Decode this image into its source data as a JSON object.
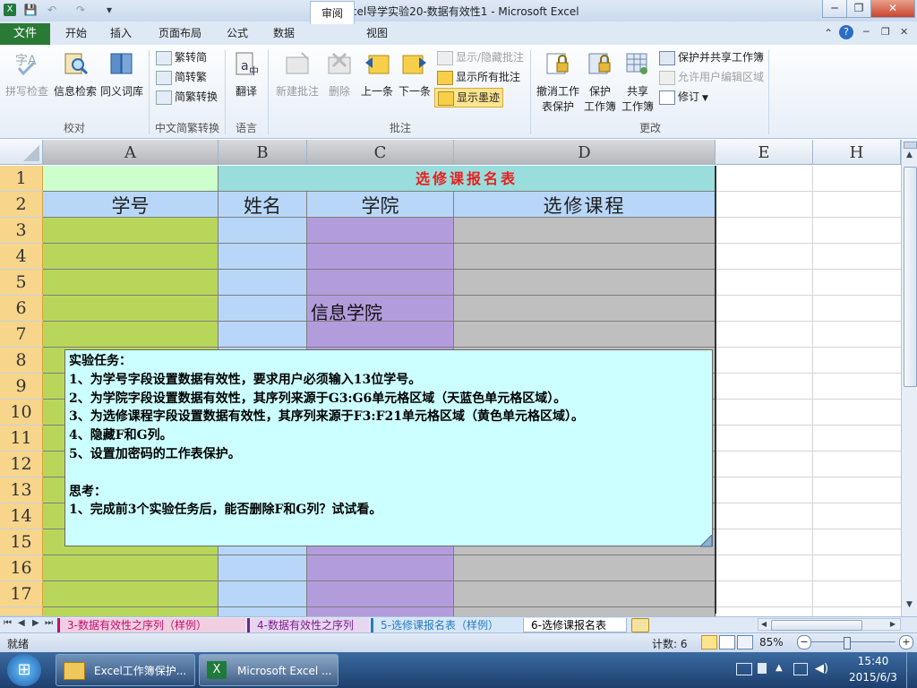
{
  "window": {
    "title": "Excel导学实验20-数据有效性1 - Microsoft Excel",
    "controls": {
      "minimize": "─",
      "restore": "❐",
      "close": "✕"
    }
  },
  "qat": {
    "save": "💾",
    "undo": "↶",
    "redo": "↷",
    "customize": "▾"
  },
  "ribbon": {
    "file_tab": "文件",
    "tabs": [
      "开始",
      "插入",
      "页面布局",
      "公式",
      "数据",
      "审阅",
      "视图"
    ],
    "active_tab": "审阅",
    "right_icons": {
      "collapse": "⌃",
      "help": "?",
      "min": "─",
      "restore": "❐",
      "close": "✕"
    },
    "groups": {
      "proofing": {
        "label": "校对",
        "spell": "拼写检查",
        "research": "信息检索",
        "thesaurus": "同义词库"
      },
      "chinese_conv": {
        "label": "中文简繁转换",
        "to_simplified": "繁转简",
        "to_traditional": "简转繁",
        "convert": "简繁转换"
      },
      "language": {
        "label": "语言",
        "translate": "翻译"
      },
      "comments": {
        "label": "批注",
        "new": "新建批注",
        "delete": "删除",
        "prev": "上一条",
        "next": "下一条",
        "show_hide": "显示/隐藏批注",
        "show_all": "显示所有批注",
        "show_ink": "显示墨迹"
      },
      "changes": {
        "label": "更改",
        "unprotect": "撤消工作表保护",
        "unprotect_l1": "撤消工作",
        "unprotect_l2": "表保护",
        "protect_l1": "保护",
        "protect_l2": "工作簿",
        "share_l1": "共享",
        "share_l2": "工作簿",
        "protect_share": "保护并共享工作簿",
        "allow_edit": "允许用户编辑区域",
        "track": "修订"
      }
    }
  },
  "grid": {
    "columns": [
      "A",
      "B",
      "C",
      "D",
      "E",
      "H"
    ],
    "rows": [
      "1",
      "2",
      "3",
      "4",
      "5",
      "6",
      "7",
      "8",
      "9",
      "10",
      "11",
      "12",
      "13",
      "14",
      "15",
      "16",
      "17"
    ],
    "title": "选修课报名表",
    "headers": {
      "a": "学号",
      "b": "姓名",
      "c": "学院",
      "d": "选修课程"
    },
    "c6": "信息学院",
    "colors": {
      "a1": "#ccffcc",
      "title_fill": "#99dddd",
      "title_text": "#e8201e",
      "header_fill": "#b8d7f8",
      "col_a": "#b8d75a",
      "col_b": "#b8d7f8",
      "col_c": "#b39cdc",
      "col_d": "#bfbfbf",
      "comment_fill": "#ccffff"
    }
  },
  "comment": {
    "lines": [
      "实验任务：",
      "1、为学号字段设置数据有效性，要求用户必须输入13位学号。",
      "2、为学院字段设置数据有效性，其序列来源于G3:G6单元格区域（天蓝色单元格区域）。",
      "3、为选修课程字段设置数据有效性，其序列来源于F3:F21单元格区域（黄色单元格区域）。",
      "4、隐藏F和G列。",
      "5、设置加密码的工作表保护。",
      "",
      "思考：",
      "1、完成前3个实验任务后，能否删除F和G列？试试看。"
    ]
  },
  "sheets": {
    "nav": [
      "⏮",
      "◀",
      "▶",
      "⏭"
    ],
    "tabs": [
      "3-数据有效性之序列（样例）",
      "4-数据有效性之序列",
      "5-选修课报名表（样例）",
      "6-选修课报名表"
    ],
    "active": "6-选修课报名表"
  },
  "status": {
    "ready": "就绪",
    "count": "计数: 6",
    "zoom": "85%",
    "zoom_level": 0.85
  },
  "taskbar": {
    "start": "⊞",
    "items": [
      "Excel工作簿保护...",
      "Microsoft Excel ..."
    ],
    "time": "15:40",
    "date": "2015/6/3"
  }
}
